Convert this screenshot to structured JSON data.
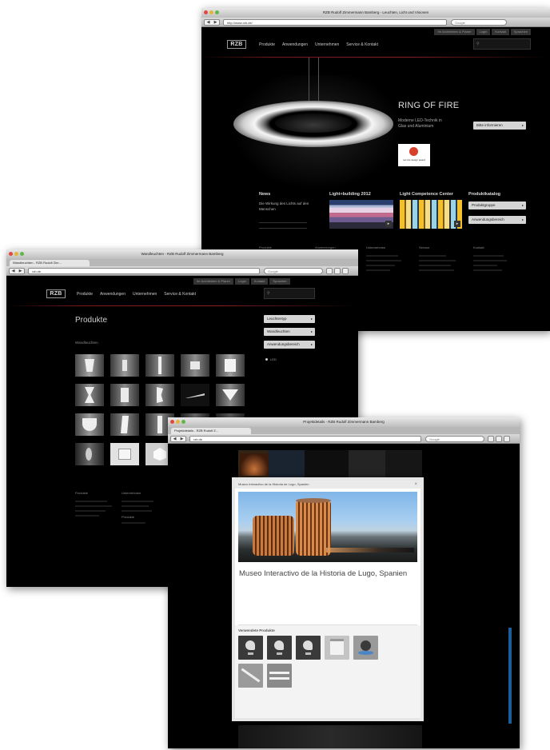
{
  "back_window": {
    "title": "RZB Rudolf Zimmermann Bamberg - Leuchten, Licht und Visionen",
    "url": "http://www.rzb.de/",
    "search_placeholder": "Google",
    "util_links": [
      "Ihr Architekten & Planer",
      "Login",
      "Kontakt",
      "Sprachen"
    ],
    "logo": "RZB",
    "menu": [
      "Produkte",
      "Anwendungen",
      "Unternehmen",
      "Service & Kontakt"
    ],
    "hero": {
      "title": "RING OF FIRE",
      "text": "Moderne LED-Technik in Glas und Aluminium",
      "button": "Bitte informieren",
      "award": "red dot design award"
    },
    "teasers": [
      {
        "title": "News",
        "text": "Die Wirkung des Lichts auf den Menschen"
      },
      {
        "title": "Light+building 2012"
      },
      {
        "title": "Light Competence Center"
      },
      {
        "title": "Produktkatalog",
        "buttons": [
          "Produktgruppe",
          "Anwendungsbereich"
        ]
      }
    ],
    "footer_cols": [
      {
        "head": "Produkte"
      },
      {
        "head": "Anwendungen"
      },
      {
        "head": "Unternehmen"
      },
      {
        "head": "Service"
      },
      {
        "head": "Kontakt"
      }
    ]
  },
  "mid_window": {
    "title": "Wandleuchten - RZB Rudolf Zimmermann Bamberg",
    "tab": "Wandleuchten - RZB Rudolf Zim...",
    "url": "rzb.de",
    "search_placeholder": "Google",
    "util_links": [
      "Ihr Architekten & Planer",
      "Login",
      "Kontakt",
      "Sprachen"
    ],
    "logo": "RZB",
    "menu": [
      "Produkte",
      "Anwendungen",
      "Unternehmen",
      "Service & Kontakt"
    ],
    "page_title": "Produkte",
    "subtitle": "Wandleuchten",
    "filters": [
      "Leuchtentyp",
      "Wandleuchten",
      "Anwendungsbereich"
    ],
    "radio_label": "LED",
    "footer_cols": [
      {
        "head": "Produkte"
      },
      {
        "head": "Unternehmen",
        "head2": "Produkte"
      }
    ]
  },
  "front_window": {
    "title": "Projektdetails - RZB Rudolf Zimmermann Bamberg",
    "tab": "Projektdetails - RZB Rudolf Z...",
    "url": "rzb.de",
    "search_placeholder": "Google",
    "modal": {
      "header": "Museo Interactivo de la Historia de Lugo, Spanien",
      "title": "Museo Interactivo de la Historia de Lugo, Spanien",
      "products_heading": "Verwendete Produkte"
    }
  },
  "colors": {
    "accent_red": "#8a1f1f",
    "page_bg": "#000000",
    "button_bg": "#d5d5d5"
  }
}
